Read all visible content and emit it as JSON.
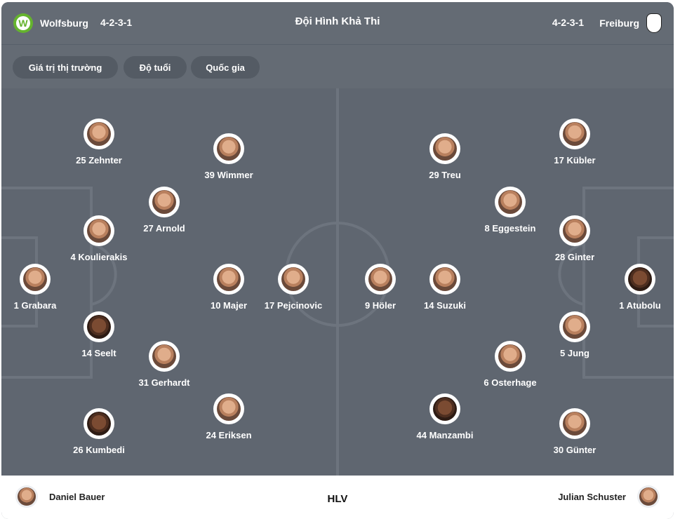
{
  "header": {
    "title": "Đội Hình Khả Thi",
    "home": {
      "name": "Wolfsburg",
      "formation": "4-2-3-1",
      "logo_icon": "wolfsburg-crest-icon",
      "logo_letter": "W"
    },
    "away": {
      "name": "Freiburg",
      "formation": "4-2-3-1",
      "logo_icon": "freiburg-crest-icon"
    }
  },
  "filters": [
    "Giá trị thị trường",
    "Độ tuổi",
    "Quốc gia"
  ],
  "home_players": [
    {
      "label": "25 Zehnter"
    },
    {
      "label": "39 Wimmer"
    },
    {
      "label": "27 Arnold"
    },
    {
      "label": "4 Koulierakis"
    },
    {
      "label": "1 Grabara"
    },
    {
      "label": "10 Majer"
    },
    {
      "label": "17 Pejcinovic"
    },
    {
      "label": "14 Seelt"
    },
    {
      "label": "31 Gerhardt"
    },
    {
      "label": "24 Eriksen"
    },
    {
      "label": "26 Kumbedi"
    }
  ],
  "away_players": [
    {
      "label": "29 Treu"
    },
    {
      "label": "17 Kübler"
    },
    {
      "label": "8 Eggestein"
    },
    {
      "label": "28 Ginter"
    },
    {
      "label": "9 Höler"
    },
    {
      "label": "14 Suzuki"
    },
    {
      "label": "1 Atubolu"
    },
    {
      "label": "5 Jung"
    },
    {
      "label": "6 Osterhage"
    },
    {
      "label": "44 Manzambi"
    },
    {
      "label": "30 Günter"
    }
  ],
  "coaches": {
    "home": "Daniel Bauer",
    "label": "HLV",
    "away": "Julian Schuster"
  },
  "colors": {
    "pitch": "#5f6670",
    "header": "#646b74",
    "chip": "#545b64",
    "wolfsburg_green": "#65b32e"
  }
}
